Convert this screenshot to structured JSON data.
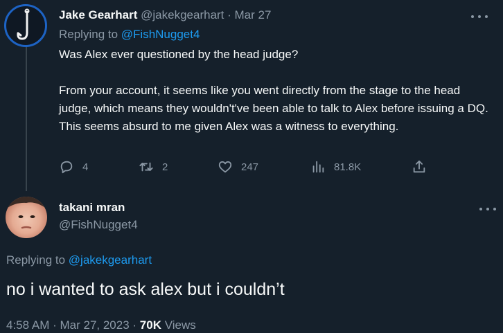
{
  "tweet1": {
    "display_name": "Jake Gearhart",
    "handle": "@jakekgearhart",
    "separator": " · ",
    "date": "Mar 27",
    "replying_prefix": "Replying to ",
    "replying_handle": "@FishNugget4",
    "body_p1": "Was Alex ever questioned by the head judge?",
    "body_p2": "From your account, it seems like you went directly from the stage to the head judge, which means they wouldn't've been able to talk to Alex before issuing a DQ. This seems absurd to me given Alex was a witness to everything.",
    "actions": {
      "replies": "4",
      "retweets": "2",
      "likes": "247",
      "views": "81.8K"
    },
    "icons": [
      "fishhook-avatar-icon",
      "reply-icon",
      "retweet-icon",
      "like-icon",
      "views-icon",
      "share-icon",
      "more-icon"
    ]
  },
  "tweet2": {
    "display_name": "takani mran",
    "handle": "@FishNugget4",
    "replying_prefix": "Replying to ",
    "replying_handle": "@jakekgearhart",
    "body": "no i wanted to ask alex but i couldn’t",
    "time": "4:58 AM",
    "separator": " · ",
    "date": "Mar 27, 2023",
    "views_count": "70K",
    "views_label": " Views"
  },
  "colors": {
    "background": "#15202b",
    "text": "#f7f9f9",
    "muted": "#8b98a5",
    "link": "#1d9bf0",
    "thread_line": "#38444d"
  }
}
